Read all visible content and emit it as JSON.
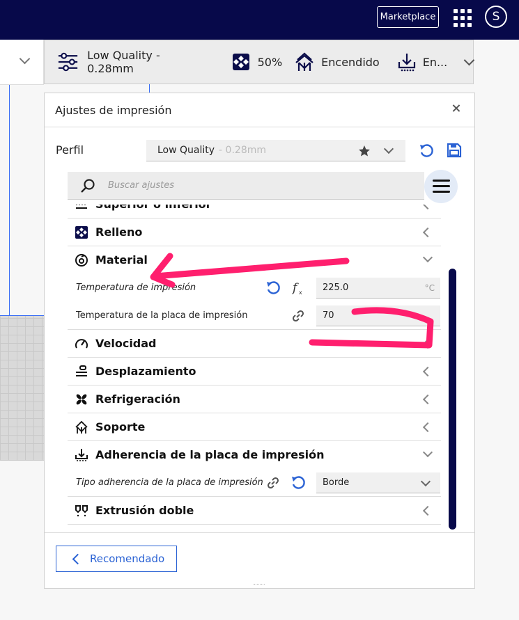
{
  "topbar": {
    "marketplace_label": "Marketplace",
    "avatar_initial": "S"
  },
  "summary": {
    "profile": "Low Quality - 0.28mm",
    "infill": "50%",
    "support": "Encendido",
    "adhesion": "En..."
  },
  "panel": {
    "title": "Ajustes de impresión",
    "perfil_label": "Perfil",
    "profile_name": "Low Quality",
    "profile_layer": "- 0.28mm",
    "search_placeholder": "Buscar ajustes",
    "categories": {
      "top_bottom": "Superior o inferior",
      "infill": "Relleno",
      "material": "Material",
      "speed": "Velocidad",
      "travel": "Desplazamiento",
      "cooling": "Refrigeración",
      "support": "Soporte",
      "adhesion": "Adherencia de la placa de impresión",
      "dual": "Extrusión doble"
    },
    "settings": {
      "print_temp_label": "Temperatura de impresión",
      "print_temp_value": "225.0",
      "print_temp_unit": "°C",
      "bed_temp_label": "Temperatura de la placa de impresión",
      "bed_temp_value": "70",
      "adhesion_type_label": "Tipo adherencia de la placa de impresión",
      "adhesion_type_value": "Borde"
    },
    "recommended_label": "Recomendado"
  },
  "colors": {
    "navy": "#07094a",
    "accent_blue": "#2a62d4",
    "annotation_pink": "#ff1f6e"
  },
  "icons": [
    "apps-grid-icon",
    "sliders-icon",
    "infill-icon",
    "support-icon",
    "adhesion-icon",
    "star-icon",
    "reset-icon",
    "save-icon",
    "search-icon",
    "hamburger-icon",
    "material-icon",
    "speed-icon",
    "travel-icon",
    "fan-icon",
    "link-icon",
    "function-icon",
    "dual-extrusion-icon"
  ]
}
